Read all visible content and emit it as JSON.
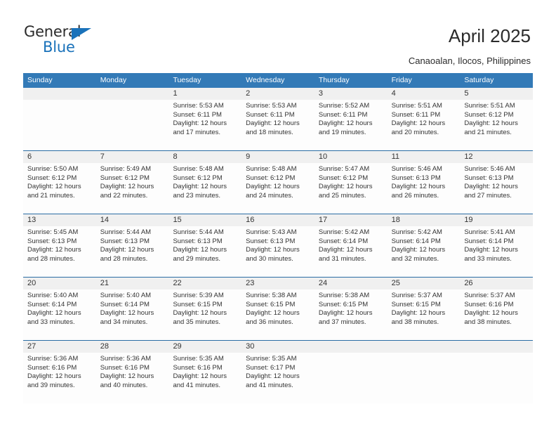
{
  "brand": {
    "name_part1": "General",
    "name_part2": "Blue",
    "triangle_icon": "triangle-icon",
    "accent_color": "#1a72ba"
  },
  "header": {
    "title": "April 2025",
    "subtitle": "Canaoalan, Ilocos, Philippines"
  },
  "theme": {
    "header_row_bg": "#337ab7",
    "week_rule": "#2a6da4",
    "daynum_band": "#f0f0f0"
  },
  "calendar": {
    "weekdays": [
      "Sunday",
      "Monday",
      "Tuesday",
      "Wednesday",
      "Thursday",
      "Friday",
      "Saturday"
    ],
    "weeks": [
      {
        "days": [
          {
            "num": "",
            "lines": []
          },
          {
            "num": "",
            "lines": []
          },
          {
            "num": "1",
            "lines": [
              "Sunrise: 5:53 AM",
              "Sunset: 6:11 PM",
              "Daylight: 12 hours",
              "and 17 minutes."
            ]
          },
          {
            "num": "2",
            "lines": [
              "Sunrise: 5:53 AM",
              "Sunset: 6:11 PM",
              "Daylight: 12 hours",
              "and 18 minutes."
            ]
          },
          {
            "num": "3",
            "lines": [
              "Sunrise: 5:52 AM",
              "Sunset: 6:11 PM",
              "Daylight: 12 hours",
              "and 19 minutes."
            ]
          },
          {
            "num": "4",
            "lines": [
              "Sunrise: 5:51 AM",
              "Sunset: 6:11 PM",
              "Daylight: 12 hours",
              "and 20 minutes."
            ]
          },
          {
            "num": "5",
            "lines": [
              "Sunrise: 5:51 AM",
              "Sunset: 6:12 PM",
              "Daylight: 12 hours",
              "and 21 minutes."
            ]
          }
        ]
      },
      {
        "days": [
          {
            "num": "6",
            "lines": [
              "Sunrise: 5:50 AM",
              "Sunset: 6:12 PM",
              "Daylight: 12 hours",
              "and 21 minutes."
            ]
          },
          {
            "num": "7",
            "lines": [
              "Sunrise: 5:49 AM",
              "Sunset: 6:12 PM",
              "Daylight: 12 hours",
              "and 22 minutes."
            ]
          },
          {
            "num": "8",
            "lines": [
              "Sunrise: 5:48 AM",
              "Sunset: 6:12 PM",
              "Daylight: 12 hours",
              "and 23 minutes."
            ]
          },
          {
            "num": "9",
            "lines": [
              "Sunrise: 5:48 AM",
              "Sunset: 6:12 PM",
              "Daylight: 12 hours",
              "and 24 minutes."
            ]
          },
          {
            "num": "10",
            "lines": [
              "Sunrise: 5:47 AM",
              "Sunset: 6:12 PM",
              "Daylight: 12 hours",
              "and 25 minutes."
            ]
          },
          {
            "num": "11",
            "lines": [
              "Sunrise: 5:46 AM",
              "Sunset: 6:13 PM",
              "Daylight: 12 hours",
              "and 26 minutes."
            ]
          },
          {
            "num": "12",
            "lines": [
              "Sunrise: 5:46 AM",
              "Sunset: 6:13 PM",
              "Daylight: 12 hours",
              "and 27 minutes."
            ]
          }
        ]
      },
      {
        "days": [
          {
            "num": "13",
            "lines": [
              "Sunrise: 5:45 AM",
              "Sunset: 6:13 PM",
              "Daylight: 12 hours",
              "and 28 minutes."
            ]
          },
          {
            "num": "14",
            "lines": [
              "Sunrise: 5:44 AM",
              "Sunset: 6:13 PM",
              "Daylight: 12 hours",
              "and 28 minutes."
            ]
          },
          {
            "num": "15",
            "lines": [
              "Sunrise: 5:44 AM",
              "Sunset: 6:13 PM",
              "Daylight: 12 hours",
              "and 29 minutes."
            ]
          },
          {
            "num": "16",
            "lines": [
              "Sunrise: 5:43 AM",
              "Sunset: 6:13 PM",
              "Daylight: 12 hours",
              "and 30 minutes."
            ]
          },
          {
            "num": "17",
            "lines": [
              "Sunrise: 5:42 AM",
              "Sunset: 6:14 PM",
              "Daylight: 12 hours",
              "and 31 minutes."
            ]
          },
          {
            "num": "18",
            "lines": [
              "Sunrise: 5:42 AM",
              "Sunset: 6:14 PM",
              "Daylight: 12 hours",
              "and 32 minutes."
            ]
          },
          {
            "num": "19",
            "lines": [
              "Sunrise: 5:41 AM",
              "Sunset: 6:14 PM",
              "Daylight: 12 hours",
              "and 33 minutes."
            ]
          }
        ]
      },
      {
        "days": [
          {
            "num": "20",
            "lines": [
              "Sunrise: 5:40 AM",
              "Sunset: 6:14 PM",
              "Daylight: 12 hours",
              "and 33 minutes."
            ]
          },
          {
            "num": "21",
            "lines": [
              "Sunrise: 5:40 AM",
              "Sunset: 6:14 PM",
              "Daylight: 12 hours",
              "and 34 minutes."
            ]
          },
          {
            "num": "22",
            "lines": [
              "Sunrise: 5:39 AM",
              "Sunset: 6:15 PM",
              "Daylight: 12 hours",
              "and 35 minutes."
            ]
          },
          {
            "num": "23",
            "lines": [
              "Sunrise: 5:38 AM",
              "Sunset: 6:15 PM",
              "Daylight: 12 hours",
              "and 36 minutes."
            ]
          },
          {
            "num": "24",
            "lines": [
              "Sunrise: 5:38 AM",
              "Sunset: 6:15 PM",
              "Daylight: 12 hours",
              "and 37 minutes."
            ]
          },
          {
            "num": "25",
            "lines": [
              "Sunrise: 5:37 AM",
              "Sunset: 6:15 PM",
              "Daylight: 12 hours",
              "and 38 minutes."
            ]
          },
          {
            "num": "26",
            "lines": [
              "Sunrise: 5:37 AM",
              "Sunset: 6:16 PM",
              "Daylight: 12 hours",
              "and 38 minutes."
            ]
          }
        ]
      },
      {
        "days": [
          {
            "num": "27",
            "lines": [
              "Sunrise: 5:36 AM",
              "Sunset: 6:16 PM",
              "Daylight: 12 hours",
              "and 39 minutes."
            ]
          },
          {
            "num": "28",
            "lines": [
              "Sunrise: 5:36 AM",
              "Sunset: 6:16 PM",
              "Daylight: 12 hours",
              "and 40 minutes."
            ]
          },
          {
            "num": "29",
            "lines": [
              "Sunrise: 5:35 AM",
              "Sunset: 6:16 PM",
              "Daylight: 12 hours",
              "and 41 minutes."
            ]
          },
          {
            "num": "30",
            "lines": [
              "Sunrise: 5:35 AM",
              "Sunset: 6:17 PM",
              "Daylight: 12 hours",
              "and 41 minutes."
            ]
          },
          {
            "num": "",
            "lines": []
          },
          {
            "num": "",
            "lines": []
          },
          {
            "num": "",
            "lines": []
          }
        ]
      }
    ]
  }
}
